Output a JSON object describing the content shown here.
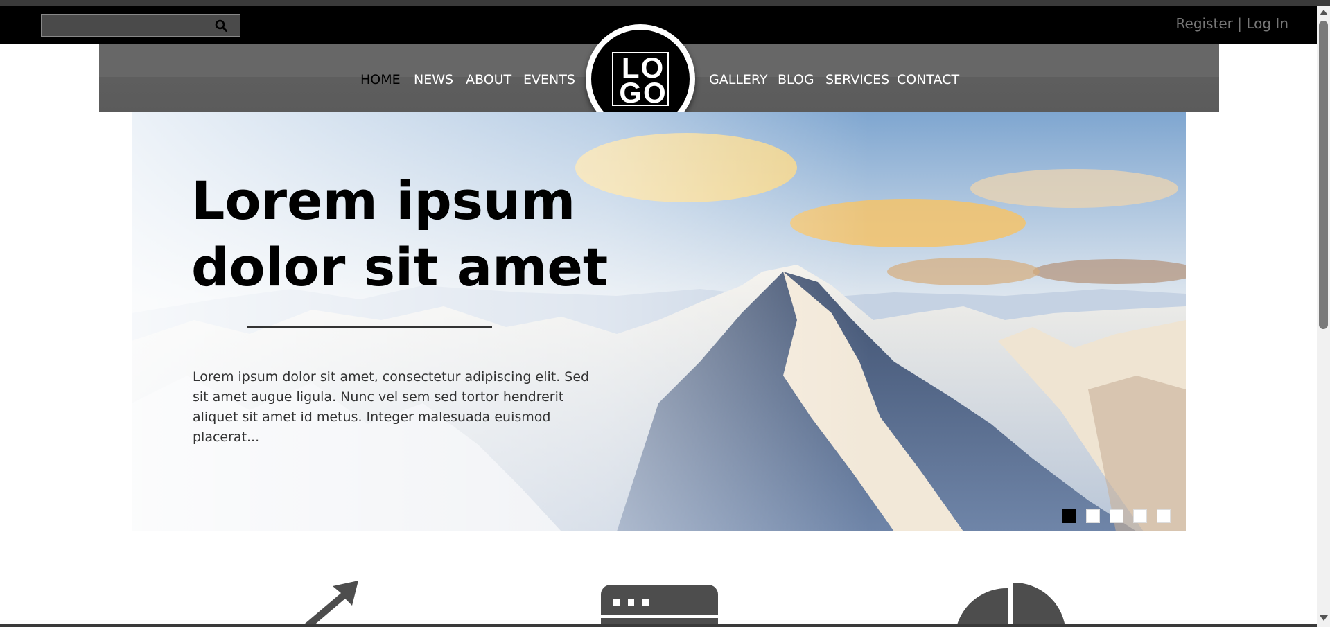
{
  "search": {
    "value": "",
    "placeholder": "",
    "icon": "search-icon"
  },
  "auth": {
    "register": "Register",
    "separator": "|",
    "login": "Log In"
  },
  "nav": {
    "left": [
      "HOME",
      "NEWS",
      "ABOUT",
      "EVENTS"
    ],
    "right": [
      "GALLERY",
      "BLOG",
      "SERVICES",
      "CONTACT"
    ],
    "active": "HOME"
  },
  "logo": {
    "line1": "LO",
    "line2": "GO"
  },
  "hero": {
    "title_line1": "Lorem ipsum",
    "title_line2": "dolor sit amet",
    "body": "Lorem ipsum dolor sit amet, consectetur adipiscing elit. Sed sit amet augue ligula. Nunc vel sem sed tortor hendrerit aliquet sit amet id metus. Integer malesuada euismod placerat...",
    "slide_count": 5,
    "active_slide": 1
  },
  "features": [
    {
      "icon": "growth-arrow-icon"
    },
    {
      "icon": "browser-window-icon"
    },
    {
      "icon": "pie-chart-icon"
    }
  ],
  "colors": {
    "topbar": "#000000",
    "nav": "#676767",
    "accent": "#000000",
    "text_muted": "#777777"
  }
}
